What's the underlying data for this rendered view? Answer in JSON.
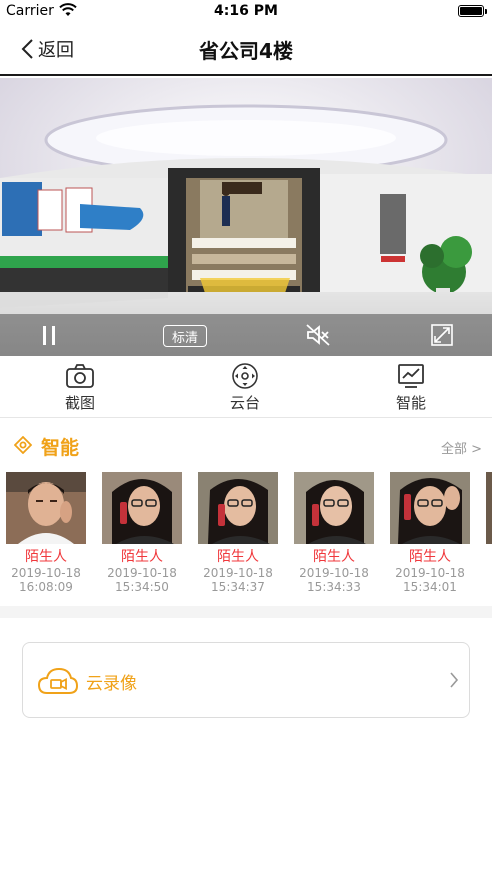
{
  "status_bar": {
    "carrier": "Carrier",
    "time": "4:16 PM"
  },
  "nav": {
    "back_label": "返回",
    "title": "省公司4楼"
  },
  "video_controls": {
    "quality_label": "标清"
  },
  "toolbar": {
    "items": [
      {
        "label": "截图",
        "icon": "camera-icon"
      },
      {
        "label": "云台",
        "icon": "ptz-icon"
      },
      {
        "label": "智能",
        "icon": "smart-chart-icon"
      }
    ]
  },
  "smart_section": {
    "title": "智能",
    "more_label": "全部 >",
    "events": [
      {
        "name": "陌生人",
        "date": "2019-10-18",
        "time": "16:08:09"
      },
      {
        "name": "陌生人",
        "date": "2019-10-18",
        "time": "15:34:50"
      },
      {
        "name": "陌生人",
        "date": "2019-10-18",
        "time": "15:34:37"
      },
      {
        "name": "陌生人",
        "date": "2019-10-18",
        "time": "15:34:33"
      },
      {
        "name": "陌生人",
        "date": "2019-10-18",
        "time": "15:34:01"
      }
    ]
  },
  "cloud_recording": {
    "label": "云录像"
  },
  "colors": {
    "accent": "#f0a219",
    "stranger": "#f0383c"
  }
}
